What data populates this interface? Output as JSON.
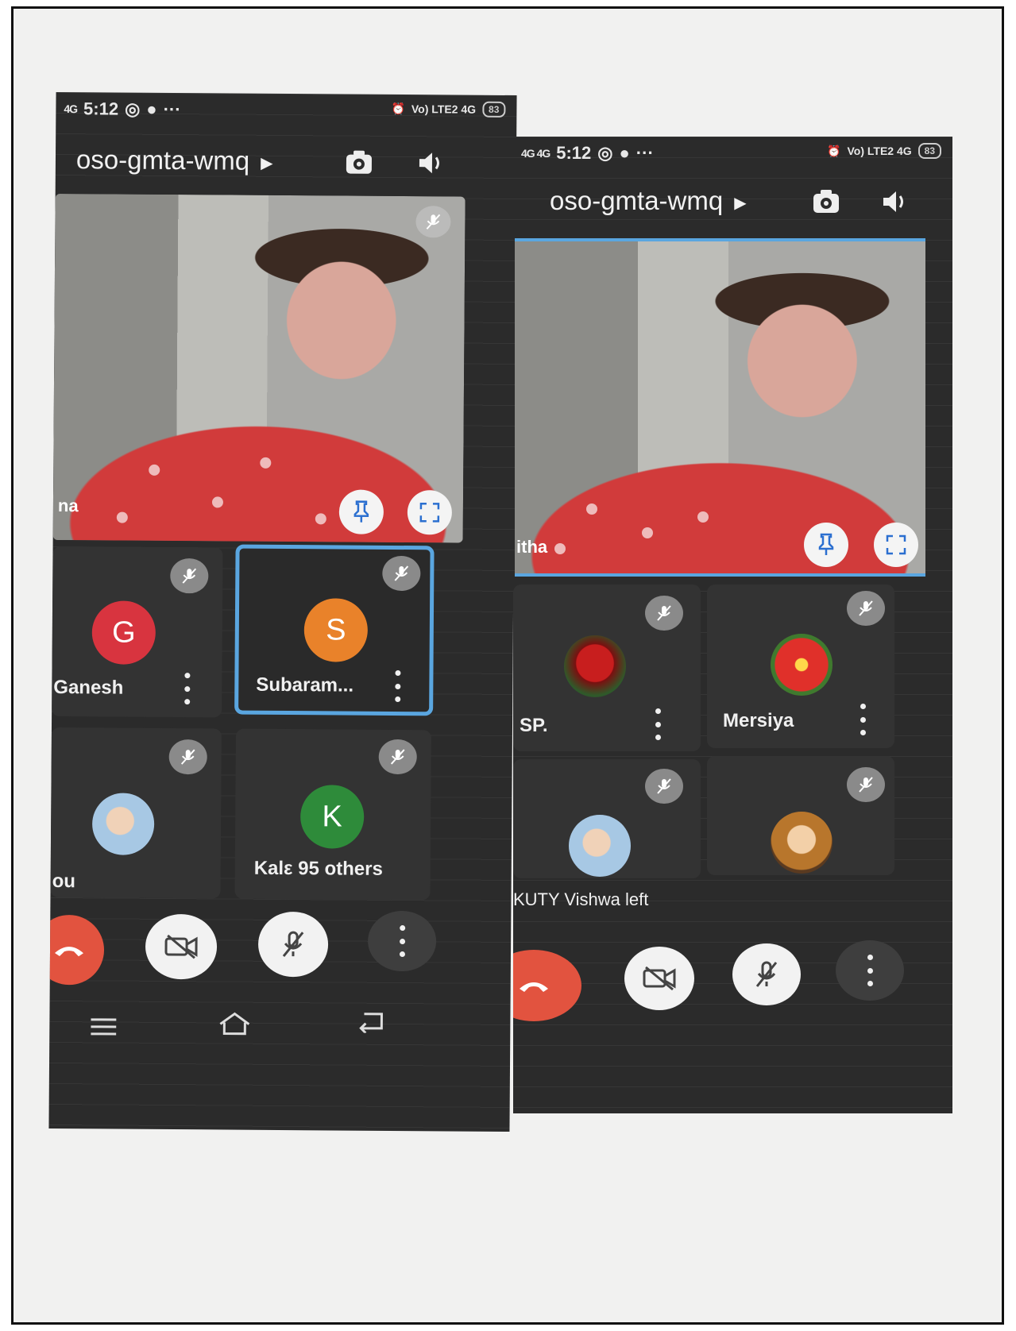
{
  "left_phone": {
    "status": {
      "time": "5:12",
      "signal": "4G",
      "network": "Vo) LTE2 4G",
      "battery": "83",
      "more": "···"
    },
    "meeting_code": "oso-gmta-wmq",
    "main_video": {
      "name": "na"
    },
    "tiles": [
      {
        "name": "Ganesh",
        "initial": "G",
        "avatar_color": "#d8343f"
      },
      {
        "name": "Subaram...",
        "initial": "S",
        "avatar_color": "#e9822a"
      },
      {
        "name": "ou"
      },
      {
        "name": "Kalε 95 others",
        "initial": "K",
        "avatar_color": "#2e8b3a"
      }
    ]
  },
  "right_phone": {
    "status": {
      "time": "5:12",
      "signal": "4G 4G",
      "network": "Vo) LTE2 4G",
      "battery": "83",
      "more": "···"
    },
    "meeting_code": "oso-gmta-wmq",
    "main_video": {
      "name": "itha"
    },
    "tiles": [
      {
        "name": "SP."
      },
      {
        "name": "Mersiya"
      },
      {
        "name": ""
      },
      {
        "name": ""
      }
    ],
    "caption": "KUTY Vishwa left"
  }
}
